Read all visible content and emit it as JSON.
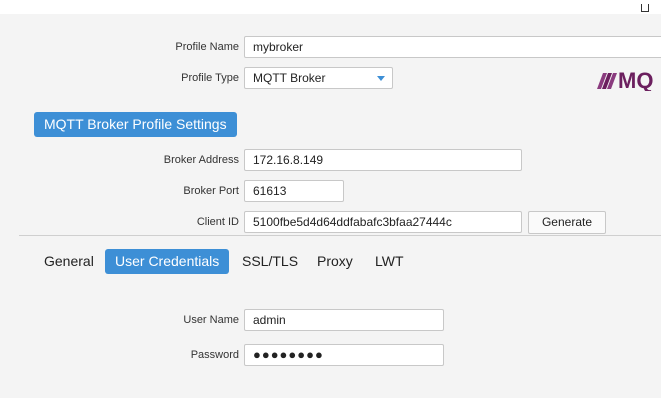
{
  "profile": {
    "name_label": "Profile Name",
    "name_value": "mybroker",
    "type_label": "Profile Type",
    "type_value": "MQTT Broker"
  },
  "logo": {
    "text": "MQ",
    "color": "#6b1f5e"
  },
  "section_title": "MQTT Broker Profile Settings",
  "broker": {
    "address_label": "Broker Address",
    "address_value": "172.16.8.149",
    "port_label": "Broker Port",
    "port_value": "61613",
    "client_id_label": "Client ID",
    "client_id_value": "5100fbe5d4d64ddfabafc3bfaa27444c",
    "generate_label": "Generate"
  },
  "tabs": [
    {
      "label": "General",
      "active": false
    },
    {
      "label": "User Credentials",
      "active": true
    },
    {
      "label": "SSL/TLS",
      "active": false
    },
    {
      "label": "Proxy",
      "active": false
    },
    {
      "label": "LWT",
      "active": false
    }
  ],
  "credentials": {
    "user_label": "User Name",
    "user_value": "admin",
    "password_label": "Password",
    "password_value": "●●●●●●●●"
  },
  "colors": {
    "accent": "#3d8fd6",
    "background": "#f4f4f4"
  }
}
